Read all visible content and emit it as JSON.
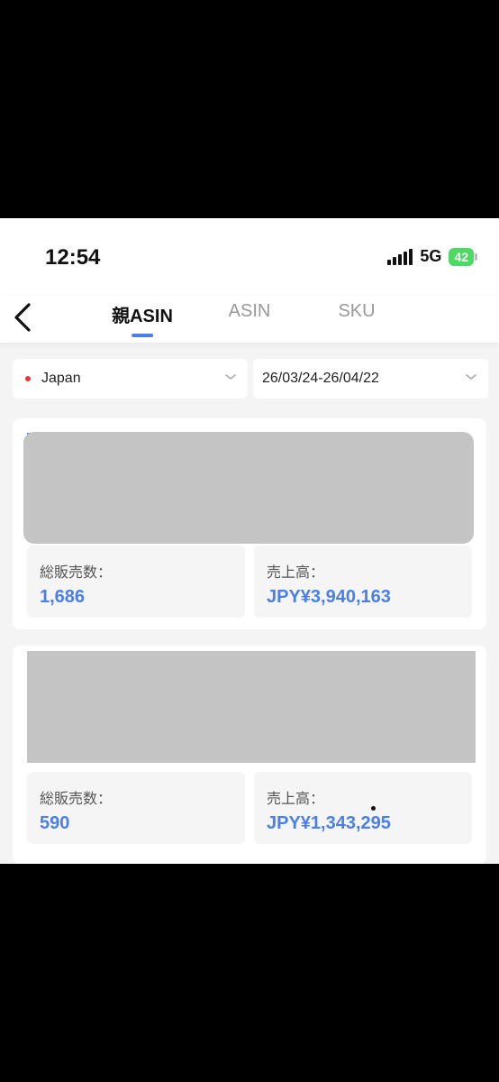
{
  "status_bar": {
    "time": "12:54",
    "network": "5G",
    "battery": "42"
  },
  "nav": {
    "tabs": [
      {
        "label": "親ASIN",
        "active": true
      },
      {
        "label": "ASIN",
        "active": false
      },
      {
        "label": "SKU",
        "active": false
      }
    ]
  },
  "filters": {
    "country": "Japan",
    "date_range": "26/03/24-26/04/22"
  },
  "products": [
    {
      "total_sales_label": "総販売数：",
      "total_sales": "1,686",
      "revenue_label": "売上高：",
      "revenue": "JPY¥3,940,163"
    },
    {
      "total_sales_label": "総販売数：",
      "total_sales": "590",
      "revenue_label": "売上高：",
      "revenue": "JPY¥1,343,295"
    }
  ],
  "colors": {
    "accent": "#4a7fe8",
    "country_dot": "#e53935",
    "battery": "#4cd964"
  }
}
